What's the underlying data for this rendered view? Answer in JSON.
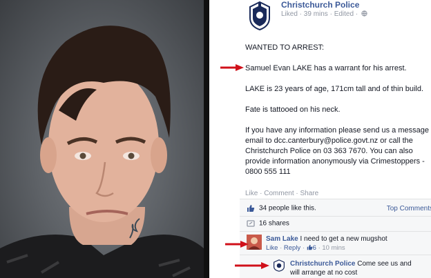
{
  "post": {
    "page_name": "Christchurch Police",
    "meta": "Liked · 39 mins · Edited ·",
    "heading": "WANTED TO ARREST:",
    "line1": "Samuel Evan LAKE has a warrant for his arrest.",
    "line2": "LAKE is 23 years of age, 171cm tall and of thin build.",
    "line3": "Fate is tattooed on his neck.",
    "para": [
      "If you have any information please send us a message",
      "email to dcc.canterbury@police.govt.nz or call the",
      "Christchurch Police on 03 363 7670. You can also",
      "provide information anonymously via Crimestoppers -",
      "0800 555 111"
    ]
  },
  "actions": {
    "like": "Like",
    "comment": "Comment",
    "share": "Share",
    "sep": " · "
  },
  "stats": {
    "likes": "34 people like this.",
    "top_comments": "Top Comments",
    "shares": "16 shares"
  },
  "comments": [
    {
      "name": "Sam Lake",
      "text": "I need to get a new mugshot",
      "meta_like": "Like",
      "meta_reply": "Reply",
      "meta_count": "6",
      "meta_time": "10 mins"
    },
    {
      "name": "Christchurch Police",
      "text": "Come see us and",
      "text2": "will arrange at no cost"
    }
  ],
  "colors": {
    "fb_blue": "#3b5998",
    "arrow_red": "#d0101a"
  }
}
